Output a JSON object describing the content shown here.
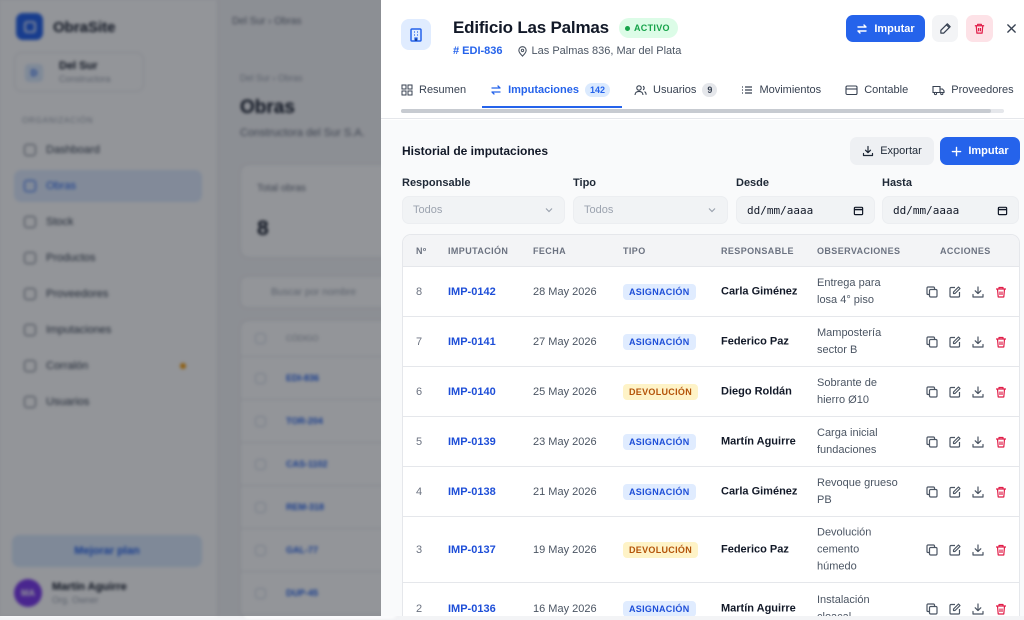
{
  "background": {
    "brand": "ObraSite",
    "org": {
      "initials": "D",
      "name": "Del Sur",
      "sub": "Constructora"
    },
    "section_label": "ORGANIZACIÓN",
    "nav": [
      "Dashboard",
      "Obras",
      "Stock",
      "Productos",
      "Proveedores",
      "Imputaciones",
      "Corralón",
      "Usuarios"
    ],
    "active_nav": "Obras",
    "upgrade_label": "Mejorar plan",
    "user": {
      "initials": "MA",
      "name": "Martín Aguirre",
      "role": "Org. Owner"
    },
    "top_crumb": [
      "Del Sur",
      "Obras"
    ],
    "page_crumb": [
      "Del Sur",
      "Obras"
    ],
    "page_title": "Obras",
    "page_subtitle": "Constructora del Sur S.A.",
    "stat": {
      "label": "Total obras",
      "value": "8"
    },
    "search_placeholder": "Buscar por nombre",
    "table_header": "CÓDIGO",
    "codes": [
      "EDI-836",
      "TOR-204",
      "CAS-1102",
      "REM-318",
      "GAL-77",
      "DUP-45"
    ]
  },
  "panel": {
    "title": "Edificio Las Palmas",
    "status": "ACTIVO",
    "code": "# EDI-836",
    "address": "Las Palmas 836, Mar del Plata",
    "impute_label": "Imputar",
    "tabs": [
      {
        "label": "Resumen",
        "icon": "grid-icon",
        "count": ""
      },
      {
        "label": "Imputaciones",
        "icon": "swap-icon",
        "count": "142"
      },
      {
        "label": "Usuarios",
        "icon": "users-icon",
        "count": "9"
      },
      {
        "label": "Movimientos",
        "icon": "list-icon",
        "count": ""
      },
      {
        "label": "Contable",
        "icon": "wallet-icon",
        "count": ""
      },
      {
        "label": "Proveedores",
        "icon": "truck-icon",
        "count": ""
      }
    ],
    "active_tab": "Imputaciones"
  },
  "history": {
    "title": "Historial de imputaciones",
    "export_label": "Exportar",
    "impute_label": "Imputar",
    "filters": {
      "responsable": {
        "label": "Responsable",
        "value": "Todos"
      },
      "tipo": {
        "label": "Tipo",
        "value": "Todos"
      },
      "desde": {
        "label": "Desde",
        "value": "dd/mm/aaaa"
      },
      "hasta": {
        "label": "Hasta",
        "value": "dd/mm/aaaa"
      }
    },
    "columns": [
      "Nº",
      "IMPUTACIÓN",
      "FECHA",
      "TIPO",
      "RESPONSABLE",
      "OBSERVACIONES",
      "ACCIONES"
    ],
    "rows": [
      {
        "n": "8",
        "code": "IMP-0142",
        "date": "28 May 2026",
        "type": "ASIGNACIÓN",
        "resp": "Carla Giménez",
        "obs": "Entrega para losa 4° piso"
      },
      {
        "n": "7",
        "code": "IMP-0141",
        "date": "27 May 2026",
        "type": "ASIGNACIÓN",
        "resp": "Federico Paz",
        "obs": "Mampostería sector B"
      },
      {
        "n": "6",
        "code": "IMP-0140",
        "date": "25 May 2026",
        "type": "DEVOLUCIÓN",
        "resp": "Diego Roldán",
        "obs": "Sobrante de hierro Ø10"
      },
      {
        "n": "5",
        "code": "IMP-0139",
        "date": "23 May 2026",
        "type": "ASIGNACIÓN",
        "resp": "Martín Aguirre",
        "obs": "Carga inicial fundaciones"
      },
      {
        "n": "4",
        "code": "IMP-0138",
        "date": "21 May 2026",
        "type": "ASIGNACIÓN",
        "resp": "Carla Giménez",
        "obs": "Revoque grueso PB"
      },
      {
        "n": "3",
        "code": "IMP-0137",
        "date": "19 May 2026",
        "type": "DEVOLUCIÓN",
        "resp": "Federico Paz",
        "obs": "Devolución cemento húmedo"
      },
      {
        "n": "2",
        "code": "IMP-0136",
        "date": "16 May 2026",
        "type": "ASIGNACIÓN",
        "resp": "Martín Aguirre",
        "obs": "Instalación cloacal"
      }
    ],
    "row_actions": [
      "copy-icon",
      "edit-icon",
      "download-icon",
      "trash-icon"
    ]
  },
  "colors": {
    "accent": "#2563eb",
    "success": "#16a34a",
    "danger": "#e11d48",
    "warning": "#b45309"
  }
}
